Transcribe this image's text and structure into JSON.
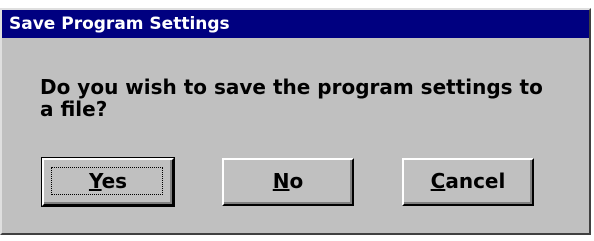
{
  "dialog": {
    "title": "Save Program Settings",
    "message": "Do you wish to save the program settings to a file?",
    "buttons": {
      "yes": {
        "mnemonic": "Y",
        "rest": "es"
      },
      "no": {
        "mnemonic": "N",
        "rest": "o"
      },
      "cancel": {
        "mnemonic": "C",
        "rest": "ancel"
      }
    },
    "default_button": "yes"
  },
  "colors": {
    "titlebar": "#000080",
    "titlebar_text": "#ffffff",
    "face": "#c0c0c0"
  }
}
